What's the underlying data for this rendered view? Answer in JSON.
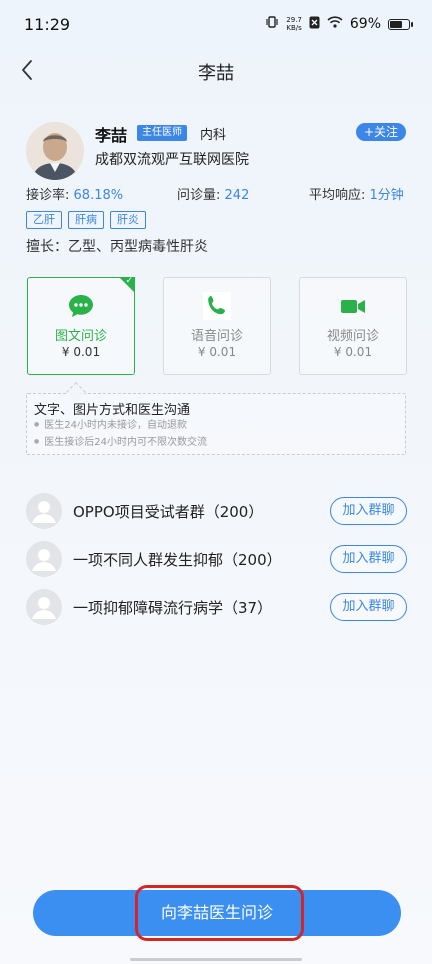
{
  "status_bar": {
    "time": "11:29",
    "net_speed_value": "29.7",
    "net_speed_unit": "KB/s",
    "battery": "69%",
    "battery_level": 0.69
  },
  "header": {
    "title": "李喆"
  },
  "doctor": {
    "name": "李喆",
    "title": "主任医师",
    "department": "内科",
    "follow_label": "+关注",
    "hospital": "成都双流观严互联网医院",
    "stats": {
      "rate_label": "接诊率:",
      "rate_value": "68.18%",
      "volume_label": "问诊量:",
      "volume_value": "242",
      "response_label": "平均响应:",
      "response_value": "1分钟"
    },
    "tags": [
      "乙肝",
      "肝病",
      "肝炎"
    ],
    "specialty": "擅长：乙型、丙型病毒性肝炎"
  },
  "consult_options": [
    {
      "label": "图文问诊",
      "price": "¥ 0.01",
      "icon": "chat-bubble-icon",
      "active": true
    },
    {
      "label": "语音问诊",
      "price": "¥ 0.01",
      "icon": "phone-icon",
      "active": false
    },
    {
      "label": "视频问诊",
      "price": "¥ 0.01",
      "icon": "video-camera-icon",
      "active": false
    }
  ],
  "description": {
    "title": "文字、图片方式和医生沟通",
    "lines": [
      "医生24小时内未接诊，自动退款",
      "医生接诊后24小时内可不限次数交流"
    ]
  },
  "groups": [
    {
      "name": "OPPO项目受试者群（200）",
      "join_label": "加入群聊"
    },
    {
      "name": "一项不同人群发生抑郁（200）",
      "join_label": "加入群聊"
    },
    {
      "name": "一项抑郁障碍流行病学（37）",
      "join_label": "加入群聊"
    }
  ],
  "bottom": {
    "consult_button": "向李喆医生问诊"
  },
  "colors": {
    "primary_blue": "#3b86e6",
    "active_green": "#2bb14a",
    "highlight_red": "#d62525"
  }
}
